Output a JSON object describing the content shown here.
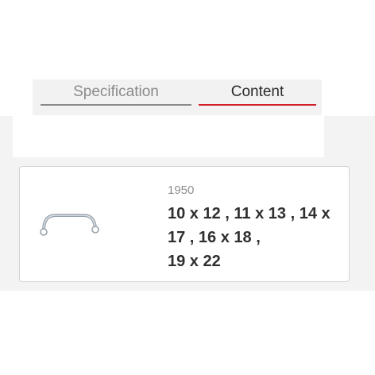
{
  "tabs": {
    "specification_label": "Specification",
    "content_label": "Content",
    "active": "Content",
    "active_color": "#d0202a"
  },
  "product": {
    "image_icon": "half-moon-ring-wrench-icon",
    "code": "1950",
    "sizes_lines": [
      "10 x 12 , 11 x 13 , 14 x",
      "17 , 16 x 18 ,",
      "19 x 22"
    ]
  }
}
